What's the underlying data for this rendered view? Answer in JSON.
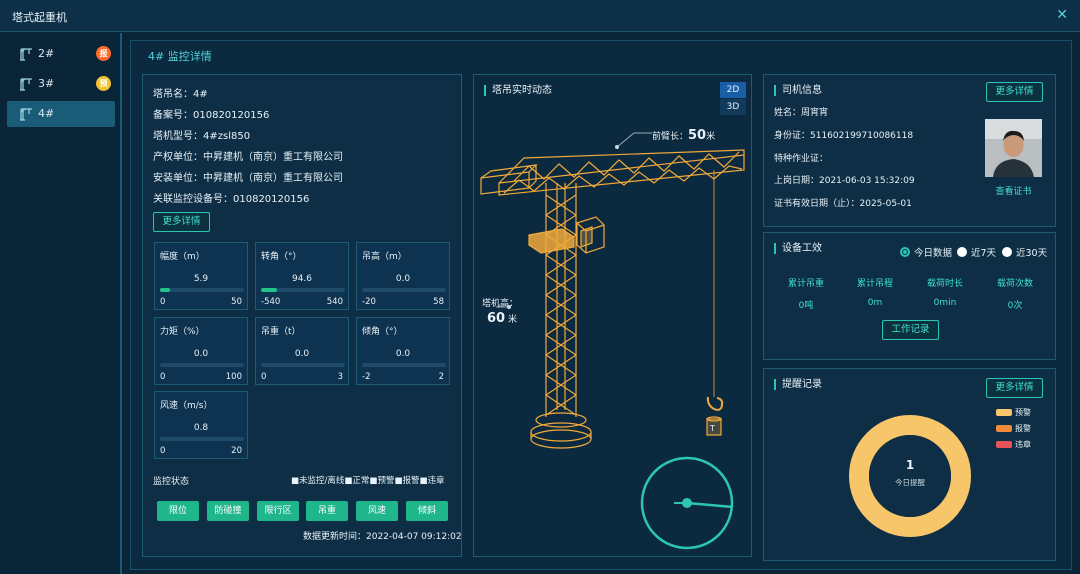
{
  "window": {
    "title": "塔式起重机",
    "close_icon": "close-icon"
  },
  "sidebar": {
    "items": [
      {
        "label": "2#",
        "badge": "报",
        "badge_color": "#ff6a2a"
      },
      {
        "label": "3#",
        "badge": "预",
        "badge_color": "#f2c12e"
      },
      {
        "label": "4#",
        "badge": "",
        "badge_color": ""
      }
    ]
  },
  "main": {
    "title": "4# 监控详情"
  },
  "info": {
    "tower_name": "塔吊名：4#",
    "record_no": "备案号：010820120156",
    "model": "塔机型号：4#zsl850",
    "owner": "产权单位：中昇建机（南京）重工有限公司",
    "installer": "安装单位：中昇建机（南京）重工有限公司",
    "device_no": "关联监控设备号：010820120156",
    "more_btn": "更多详情"
  },
  "gauges": [
    {
      "title": "幅度（m）",
      "value": "5.9",
      "min": "0",
      "max": "50",
      "fill": 0.118
    },
    {
      "title": "转角（°）",
      "value": "94.6",
      "min": "-540",
      "max": "540",
      "fill": 0.19
    },
    {
      "title": "吊高（m）",
      "value": "0.0",
      "min": "-20",
      "max": "58",
      "fill": 0
    },
    {
      "title": "力矩（%）",
      "value": "0.0",
      "min": "0",
      "max": "100",
      "fill": 0
    },
    {
      "title": "吊重（t）",
      "value": "0.0",
      "min": "0",
      "max": "3",
      "fill": 0
    },
    {
      "title": "倾角（°）",
      "value": "0.0",
      "min": "-2",
      "max": "2",
      "fill": 0
    },
    {
      "title": "风速（m/s）",
      "value": "0.8",
      "min": "0",
      "max": "20",
      "fill": 0
    }
  ],
  "monitor": {
    "label": "监控状态",
    "legend": "■未监控/离线■正常■预警■报警■违章",
    "buttons": [
      "限位",
      "防碰撞",
      "限行区",
      "吊重",
      "风速",
      "倾斜"
    ],
    "updated": "数据更新时间：2022-04-07 09:12:02"
  },
  "crane": {
    "title": "塔吊实时动态",
    "view_2d": "2D",
    "view_3d": "3D",
    "jib_label": "前臂长：",
    "jib_value": "50",
    "jib_unit": "米",
    "height_label": "塔机高：",
    "height_value": "60",
    "height_unit": "米",
    "hook_label": "T"
  },
  "driver": {
    "title": "司机信息",
    "more_btn": "更多详情",
    "name": "姓名：周宵宵",
    "id_card": "身份证：511602199710086118",
    "special": "特种作业证：",
    "upload_date": "上岗日期：2021-06-03 15:32:09",
    "valid_until": "证书有效日期（止）：2025-05-01",
    "view_cert": "查看证书"
  },
  "efficiency": {
    "title": "设备工效",
    "options": [
      "今日数据",
      "近7天",
      "近30天"
    ],
    "selected": 0,
    "stats": [
      {
        "label": "累计吊重",
        "value": "0吨"
      },
      {
        "label": "累计吊程",
        "value": "0m"
      },
      {
        "label": "载荷时长",
        "value": "0min"
      },
      {
        "label": "载荷次数",
        "value": "0次"
      }
    ],
    "work_btn": "工作记录"
  },
  "reminders": {
    "title": "提醒记录",
    "more_btn": "更多详情",
    "count": "1",
    "count_label": "今日提醒",
    "legend": [
      {
        "label": "预警",
        "color": "#f7c66b"
      },
      {
        "label": "报警",
        "color": "#f08a3c"
      },
      {
        "label": "违章",
        "color": "#e8525a"
      }
    ],
    "ring_color": "#f7c66b"
  },
  "colors": {
    "accent": "#2ec4b6",
    "crane": "#f2a93b",
    "normal": "#20c38a"
  }
}
